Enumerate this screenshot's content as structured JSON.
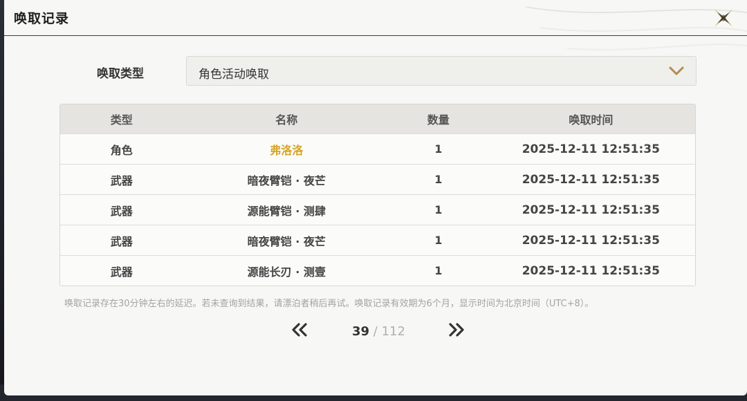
{
  "header": {
    "title": "唤取记录"
  },
  "filter": {
    "label": "唤取类型",
    "selected": "角色活动唤取"
  },
  "table": {
    "columns": [
      "类型",
      "名称",
      "数量",
      "唤取时间"
    ],
    "rows": [
      {
        "type": "角色",
        "name": "弗洛洛",
        "qty": "1",
        "time": "2025-12-11 12:51:35",
        "highlight": true
      },
      {
        "type": "武器",
        "name": "暗夜臂铠 · 夜芒",
        "qty": "1",
        "time": "2025-12-11 12:51:35",
        "highlight": false
      },
      {
        "type": "武器",
        "name": "源能臂铠 · 测肆",
        "qty": "1",
        "time": "2025-12-11 12:51:35",
        "highlight": false
      },
      {
        "type": "武器",
        "name": "暗夜臂铠 · 夜芒",
        "qty": "1",
        "time": "2025-12-11 12:51:35",
        "highlight": false
      },
      {
        "type": "武器",
        "name": "源能长刃 · 测壹",
        "qty": "1",
        "time": "2025-12-11 12:51:35",
        "highlight": false
      }
    ]
  },
  "note": "唤取记录存在30分钟左右的延迟。若未查询到结果，请漂泊者稍后再试。唤取记录有效期为6个月，显示时间为北京时间（UTC+8）。",
  "pager": {
    "current": "39",
    "separator": " / ",
    "total": "112"
  },
  "colors": {
    "highlight": "#d4a424",
    "close_icon": "#b08d4f",
    "chevron": "#b08d4f"
  },
  "icons": {
    "close": "close-x-icon",
    "dropdown": "chevron-down-icon",
    "prev": "double-chevron-left-icon",
    "next": "double-chevron-right-icon"
  }
}
